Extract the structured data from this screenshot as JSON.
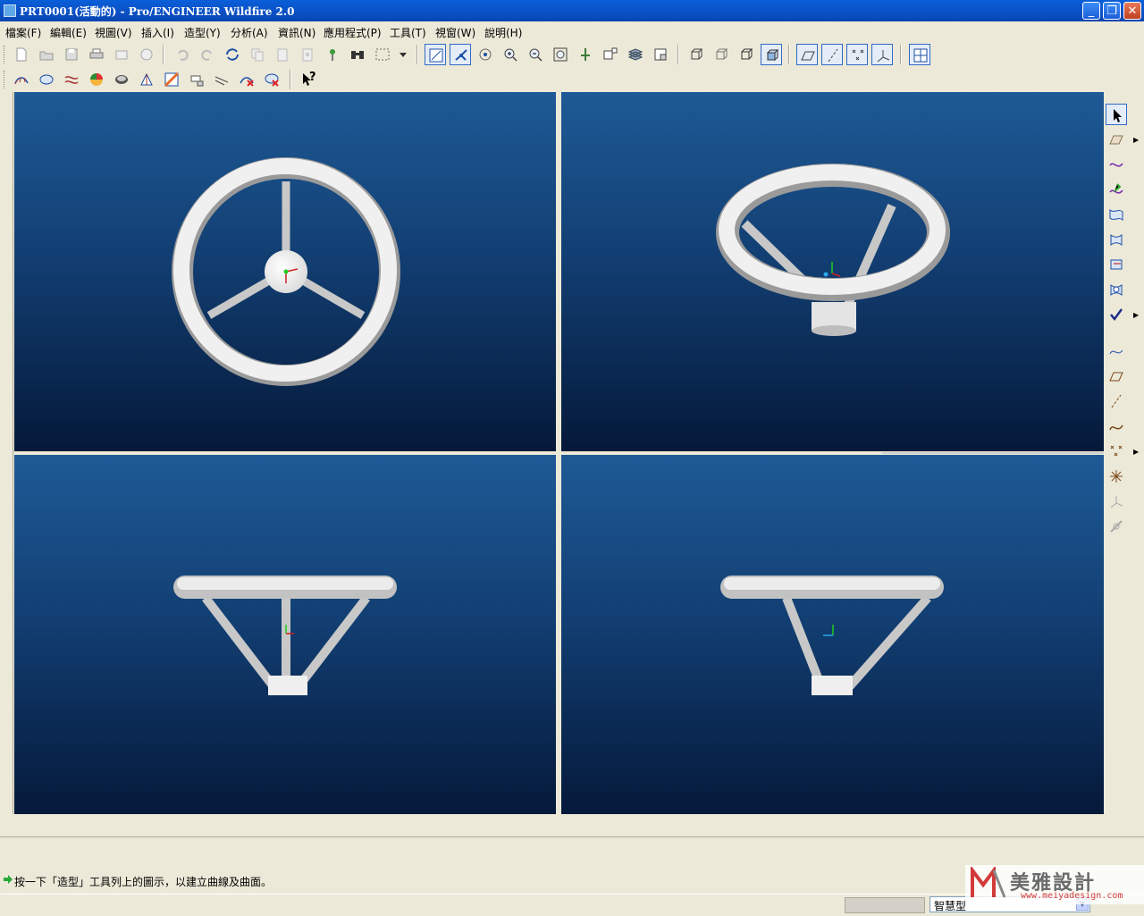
{
  "window": {
    "title": "PRT0001(活動的) - Pro/ENGINEER Wildfire 2.0",
    "minimize": "_",
    "maximize": "❐",
    "close": "✕"
  },
  "menubar": {
    "items": [
      "檔案(F)",
      "編輯(E)",
      "視圖(V)",
      "插入(I)",
      "造型(Y)",
      "分析(A)",
      "資訊(N)",
      "應用程式(P)",
      "工具(T)",
      "視窗(W)",
      "說明(H)"
    ]
  },
  "toolbar": {
    "row1_icons": [
      "new-icon",
      "open-icon",
      "save-icon",
      "print-icon",
      "email-icon",
      "email-link-icon",
      "undo-icon",
      "redo-icon",
      "regenerate-icon",
      "copy-icon",
      "paste-icon",
      "paste-special-icon",
      "model-tree-icon",
      "find-icon",
      "select-box-icon",
      "dropdown-icon",
      "sketch-view-icon",
      "datum-display-icon",
      "spin-center-icon",
      "zoom-in-icon",
      "zoom-out-icon",
      "refit-icon",
      "reorient-icon",
      "saved-views-icon",
      "layers-icon",
      "view-manager-icon",
      "wireframe-icon",
      "hidden-line-icon",
      "no-hidden-icon",
      "shading-icon",
      "datum-planes-icon",
      "datum-axes-icon",
      "datum-points-icon",
      "coord-systems-icon",
      "multi-view-icon"
    ],
    "row2_icons": [
      "curvature-icon",
      "section-icon",
      "offset-icon",
      "reflection-icon",
      "shade-analysis-icon",
      "slope-icon",
      "draft-icon",
      "dihedral-icon",
      "curve-analysis-icon",
      "delete-analysis-icon",
      "clear-analysis-icon",
      "whats-this-icon"
    ],
    "help_label": "?"
  },
  "right_toolbar": {
    "icons": [
      "select-arrow-icon",
      "active-plane-icon",
      "create-curve-icon",
      "drop-curve-icon",
      "cos-curve-icon",
      "surface-icon",
      "connect-surface-icon",
      "trim-surface-icon",
      "edit-surface-icon",
      "done-check-icon",
      "datum-curve-icon",
      "datum-plane-icon",
      "datum-axis-icon",
      "sketched-curve-icon",
      "datum-point-icon",
      "offset-point-icon",
      "csys-icon",
      "analysis-feature-icon"
    ]
  },
  "viewports": [
    {
      "view": "front"
    },
    {
      "view": "isometric"
    },
    {
      "view": "side"
    },
    {
      "view": "side-alt"
    }
  ],
  "colors": {
    "viewport_top": "#1e5a96",
    "viewport_bottom": "#05193a",
    "model": "#f2f2f2",
    "titlebar": "#0a5fd8"
  },
  "message": {
    "text": "按一下「造型」工具列上的圖示，以建立曲線及曲面。"
  },
  "status": {
    "filter_value": "智慧型"
  },
  "watermark": {
    "brand": "美雅設計",
    "url": "www.meiyadesign.com"
  }
}
